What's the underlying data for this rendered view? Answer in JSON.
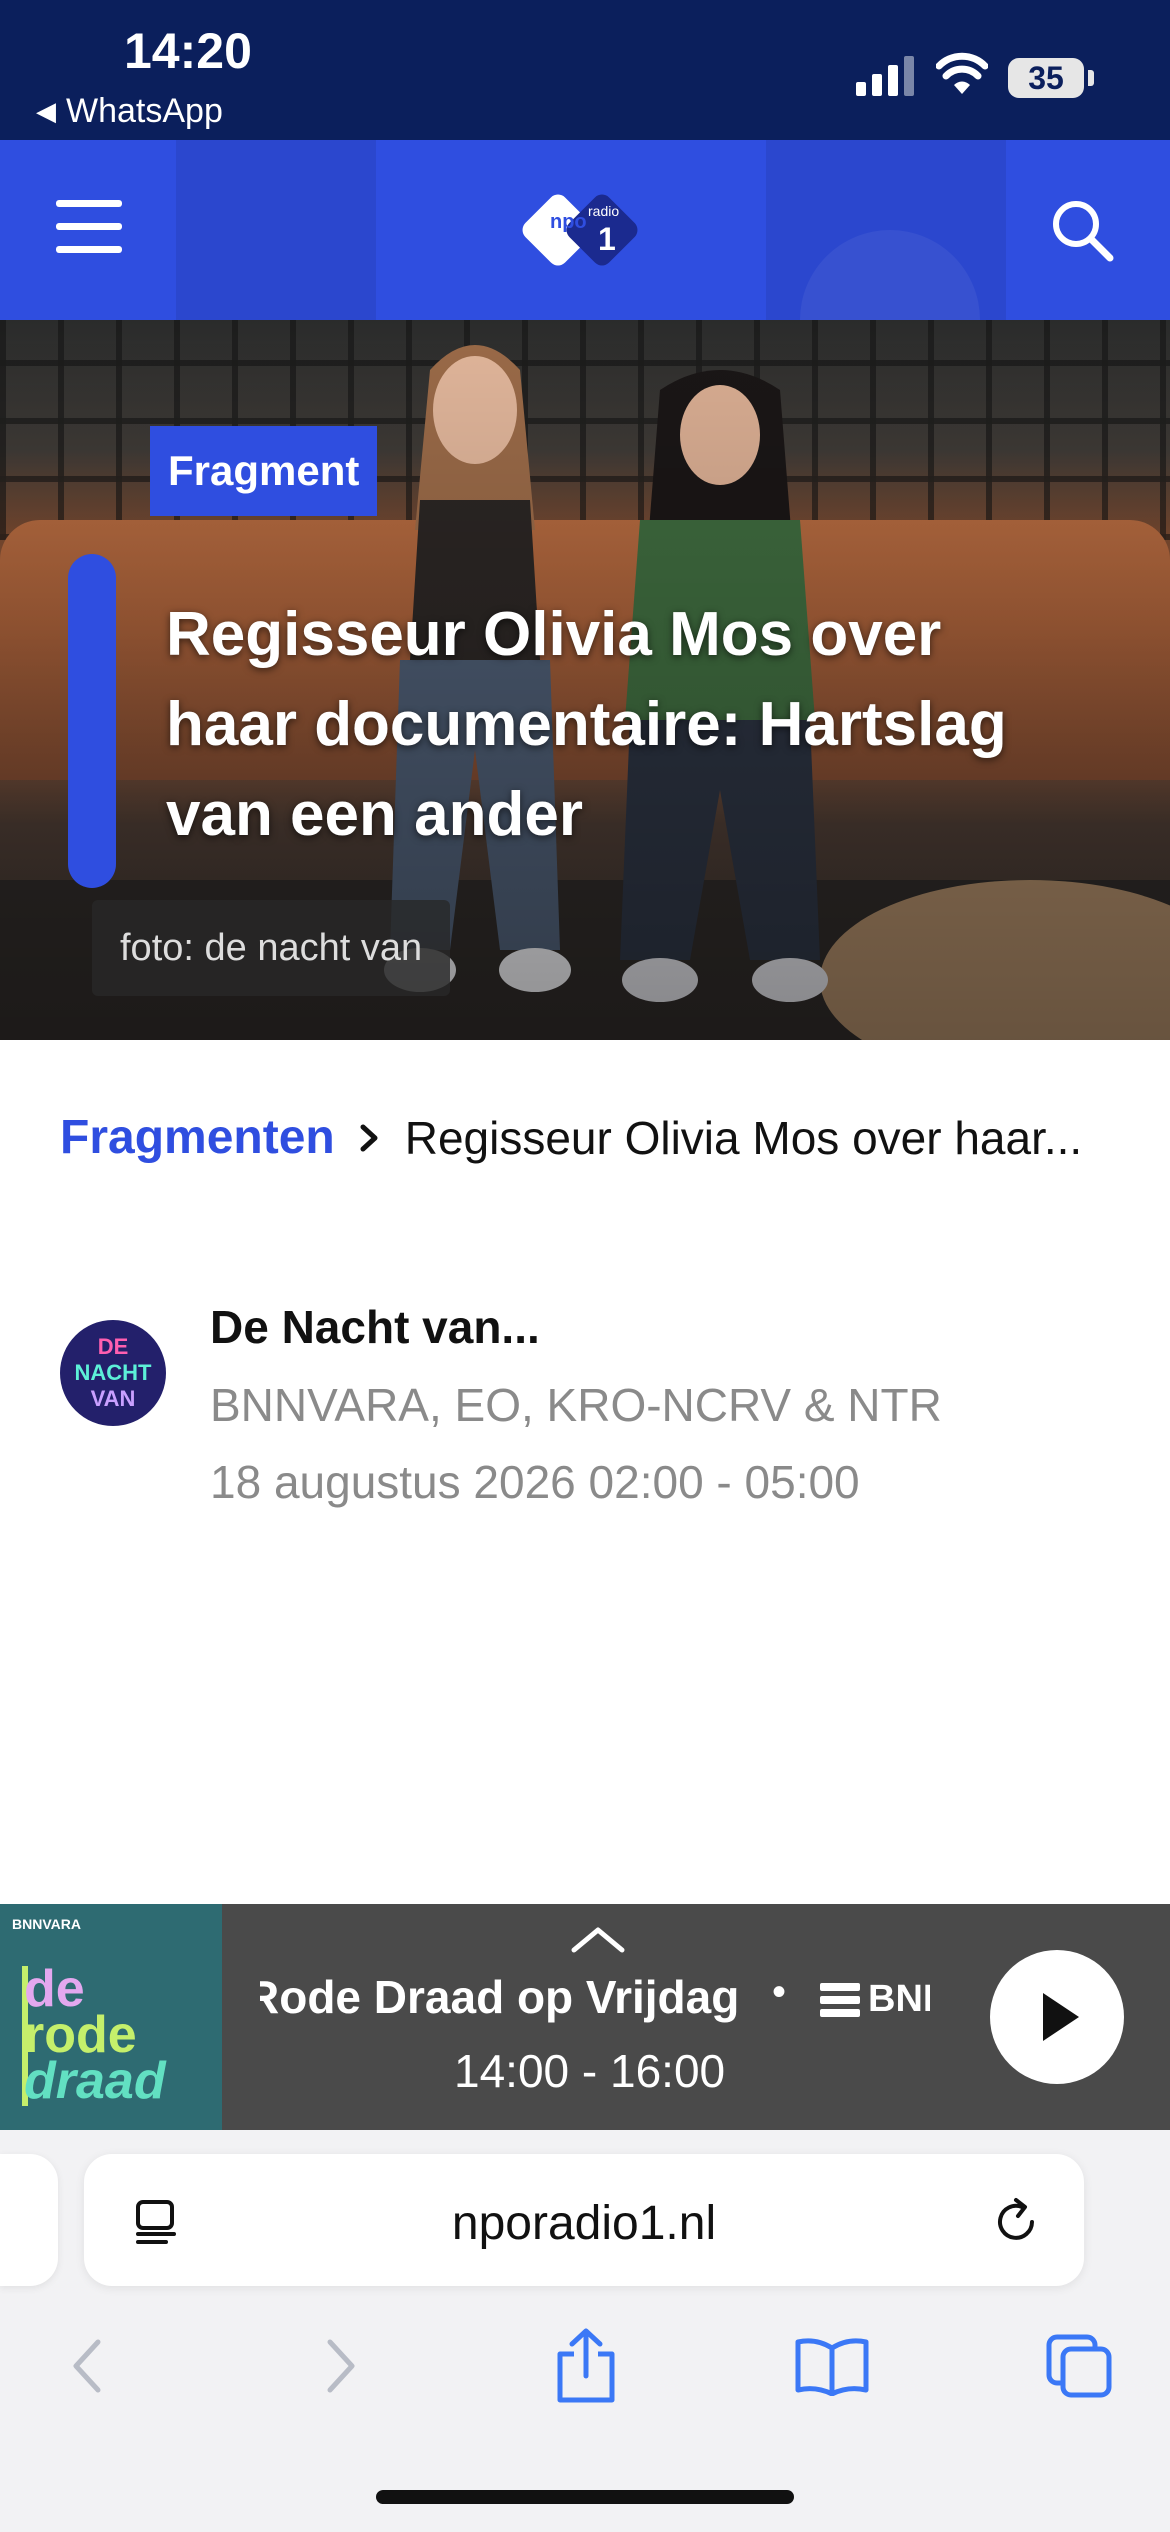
{
  "status_bar": {
    "time": "14:20",
    "back_app": "WhatsApp",
    "battery": "35"
  },
  "header": {
    "menu_icon": "hamburger-menu-icon",
    "logo_text_top": "npo",
    "logo_text_radio": "radio",
    "logo_text_number": "1",
    "search_icon": "search-icon",
    "brand_color": "#2f4ee0"
  },
  "hero": {
    "tag": "Fragment",
    "title": "Regisseur Olivia Mos over haar documentaire: Hartslag van een ander",
    "photo_credit": "foto: de nacht van"
  },
  "breadcrumb": {
    "link": "Fragmenten",
    "current": "Regisseur Olivia Mos over haar..."
  },
  "program": {
    "avatar_line1": "DE",
    "avatar_line2": "NACHT",
    "avatar_line3": "VAN",
    "name": "De Nacht van...",
    "broadcasters": "BNNVARA, EO, KRO-NCRV & NTR",
    "time": "18 augustus 2026 02:00 - 05:00"
  },
  "player": {
    "thumb_brand": "BNNVARA",
    "thumb_logo_1": "de",
    "thumb_logo_2": "rode",
    "thumb_logo_3": "draad",
    "title": "Rode Draad op Vrijdag",
    "separator": "•",
    "broadcaster_logo": "BNN",
    "time": "14:00 - 16:00",
    "play_icon": "play-icon"
  },
  "browser": {
    "url": "nporadio1.nl",
    "reader_icon": "reader-mode-icon",
    "reload_icon": "reload-icon",
    "nav_icons": [
      "back-icon",
      "forward-icon",
      "share-icon",
      "bookmarks-icon",
      "tabs-icon"
    ]
  }
}
